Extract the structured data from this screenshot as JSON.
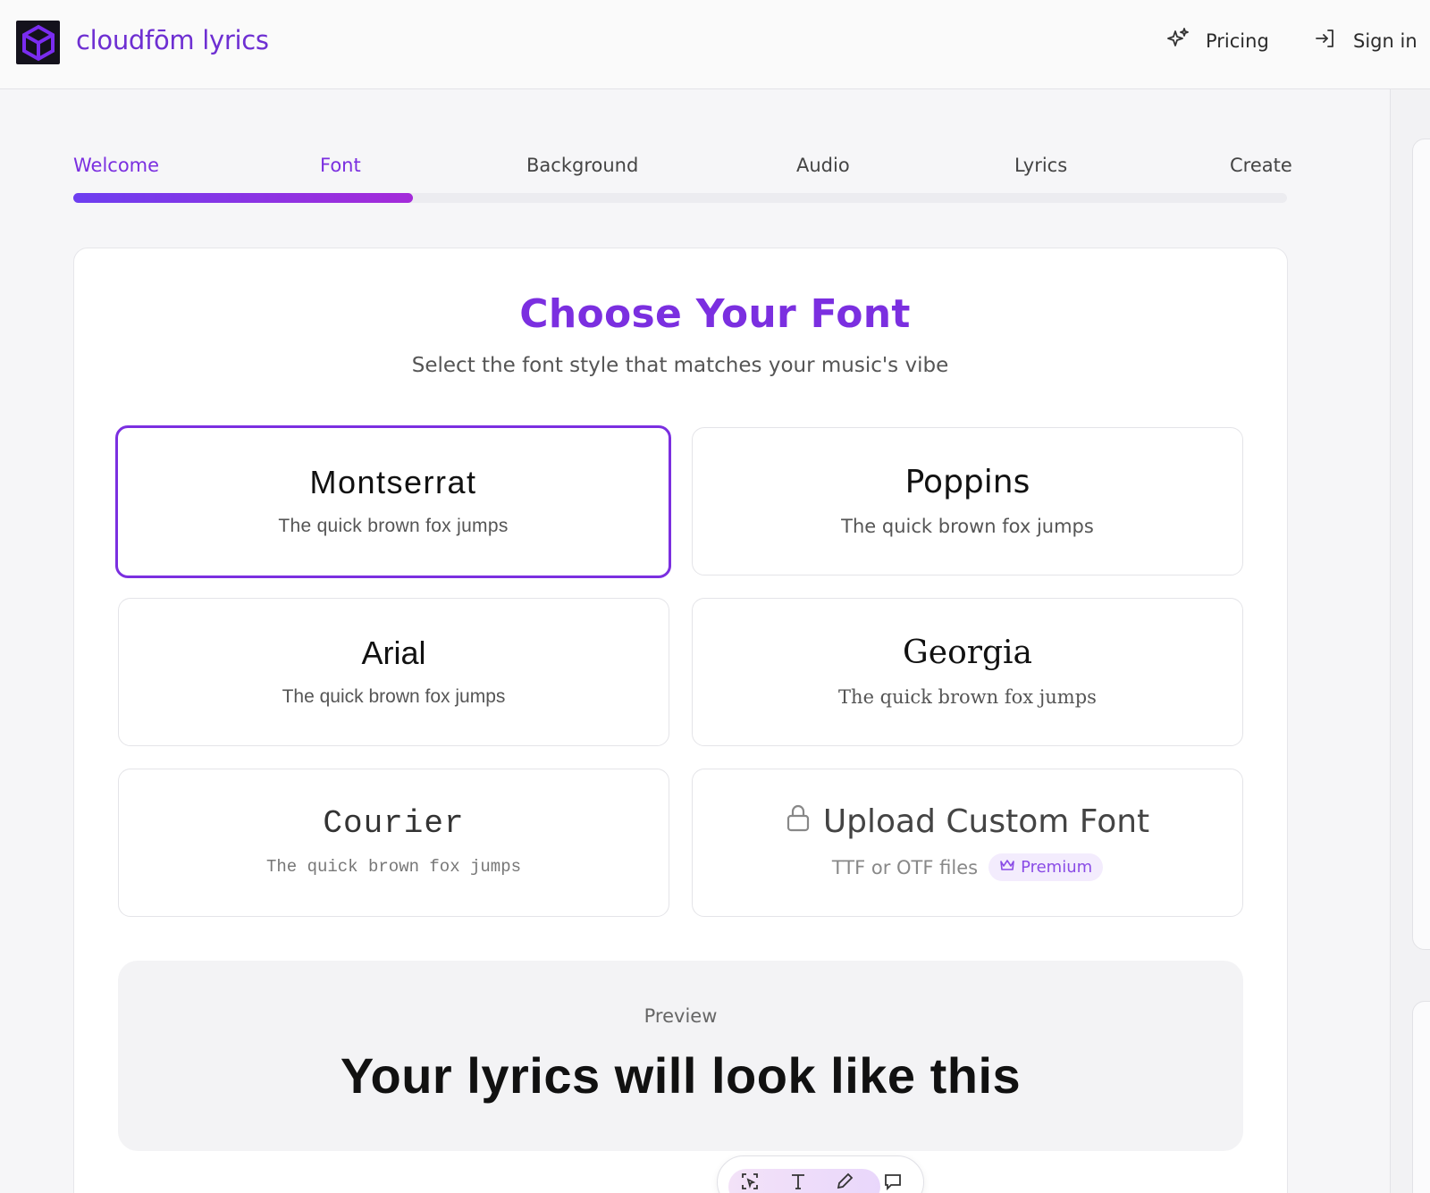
{
  "header": {
    "brand": "cloudfōm lyrics",
    "pricing_label": "Pricing",
    "signin_label": "Sign in"
  },
  "steps": [
    {
      "label": "Welcome",
      "active": true
    },
    {
      "label": "Font",
      "active": true
    },
    {
      "label": "Background",
      "active": false
    },
    {
      "label": "Audio",
      "active": false
    },
    {
      "label": "Lyrics",
      "active": false
    },
    {
      "label": "Create",
      "active": false
    }
  ],
  "progress": {
    "completed_steps": 2,
    "total_steps": 6
  },
  "main": {
    "title": "Choose Your Font",
    "subtitle": "Select the font style that matches your music's vibe"
  },
  "fonts": [
    {
      "name": "Montserrat",
      "sample": "The quick brown fox jumps",
      "selected": true
    },
    {
      "name": "Poppins",
      "sample": "The quick brown fox jumps",
      "selected": false
    },
    {
      "name": "Arial",
      "sample": "The quick brown fox jumps",
      "selected": false
    },
    {
      "name": "Georgia",
      "sample": "The quick brown fox jumps",
      "selected": false
    },
    {
      "name": "Courier",
      "sample": "The quick brown fox jumps",
      "selected": false
    }
  ],
  "upload": {
    "label": "Upload Custom Font",
    "sub": "TTF or OTF files",
    "badge": "Premium",
    "locked": true
  },
  "preview": {
    "label": "Preview",
    "text": "Your lyrics will look like this"
  },
  "toolbar": {
    "icons": [
      "select-icon",
      "text-icon",
      "pencil-icon",
      "comment-icon"
    ]
  },
  "colors": {
    "accent": "#7b2fe0",
    "brand": "#6e2fd2",
    "premium_bg": "#f3ecfd"
  }
}
